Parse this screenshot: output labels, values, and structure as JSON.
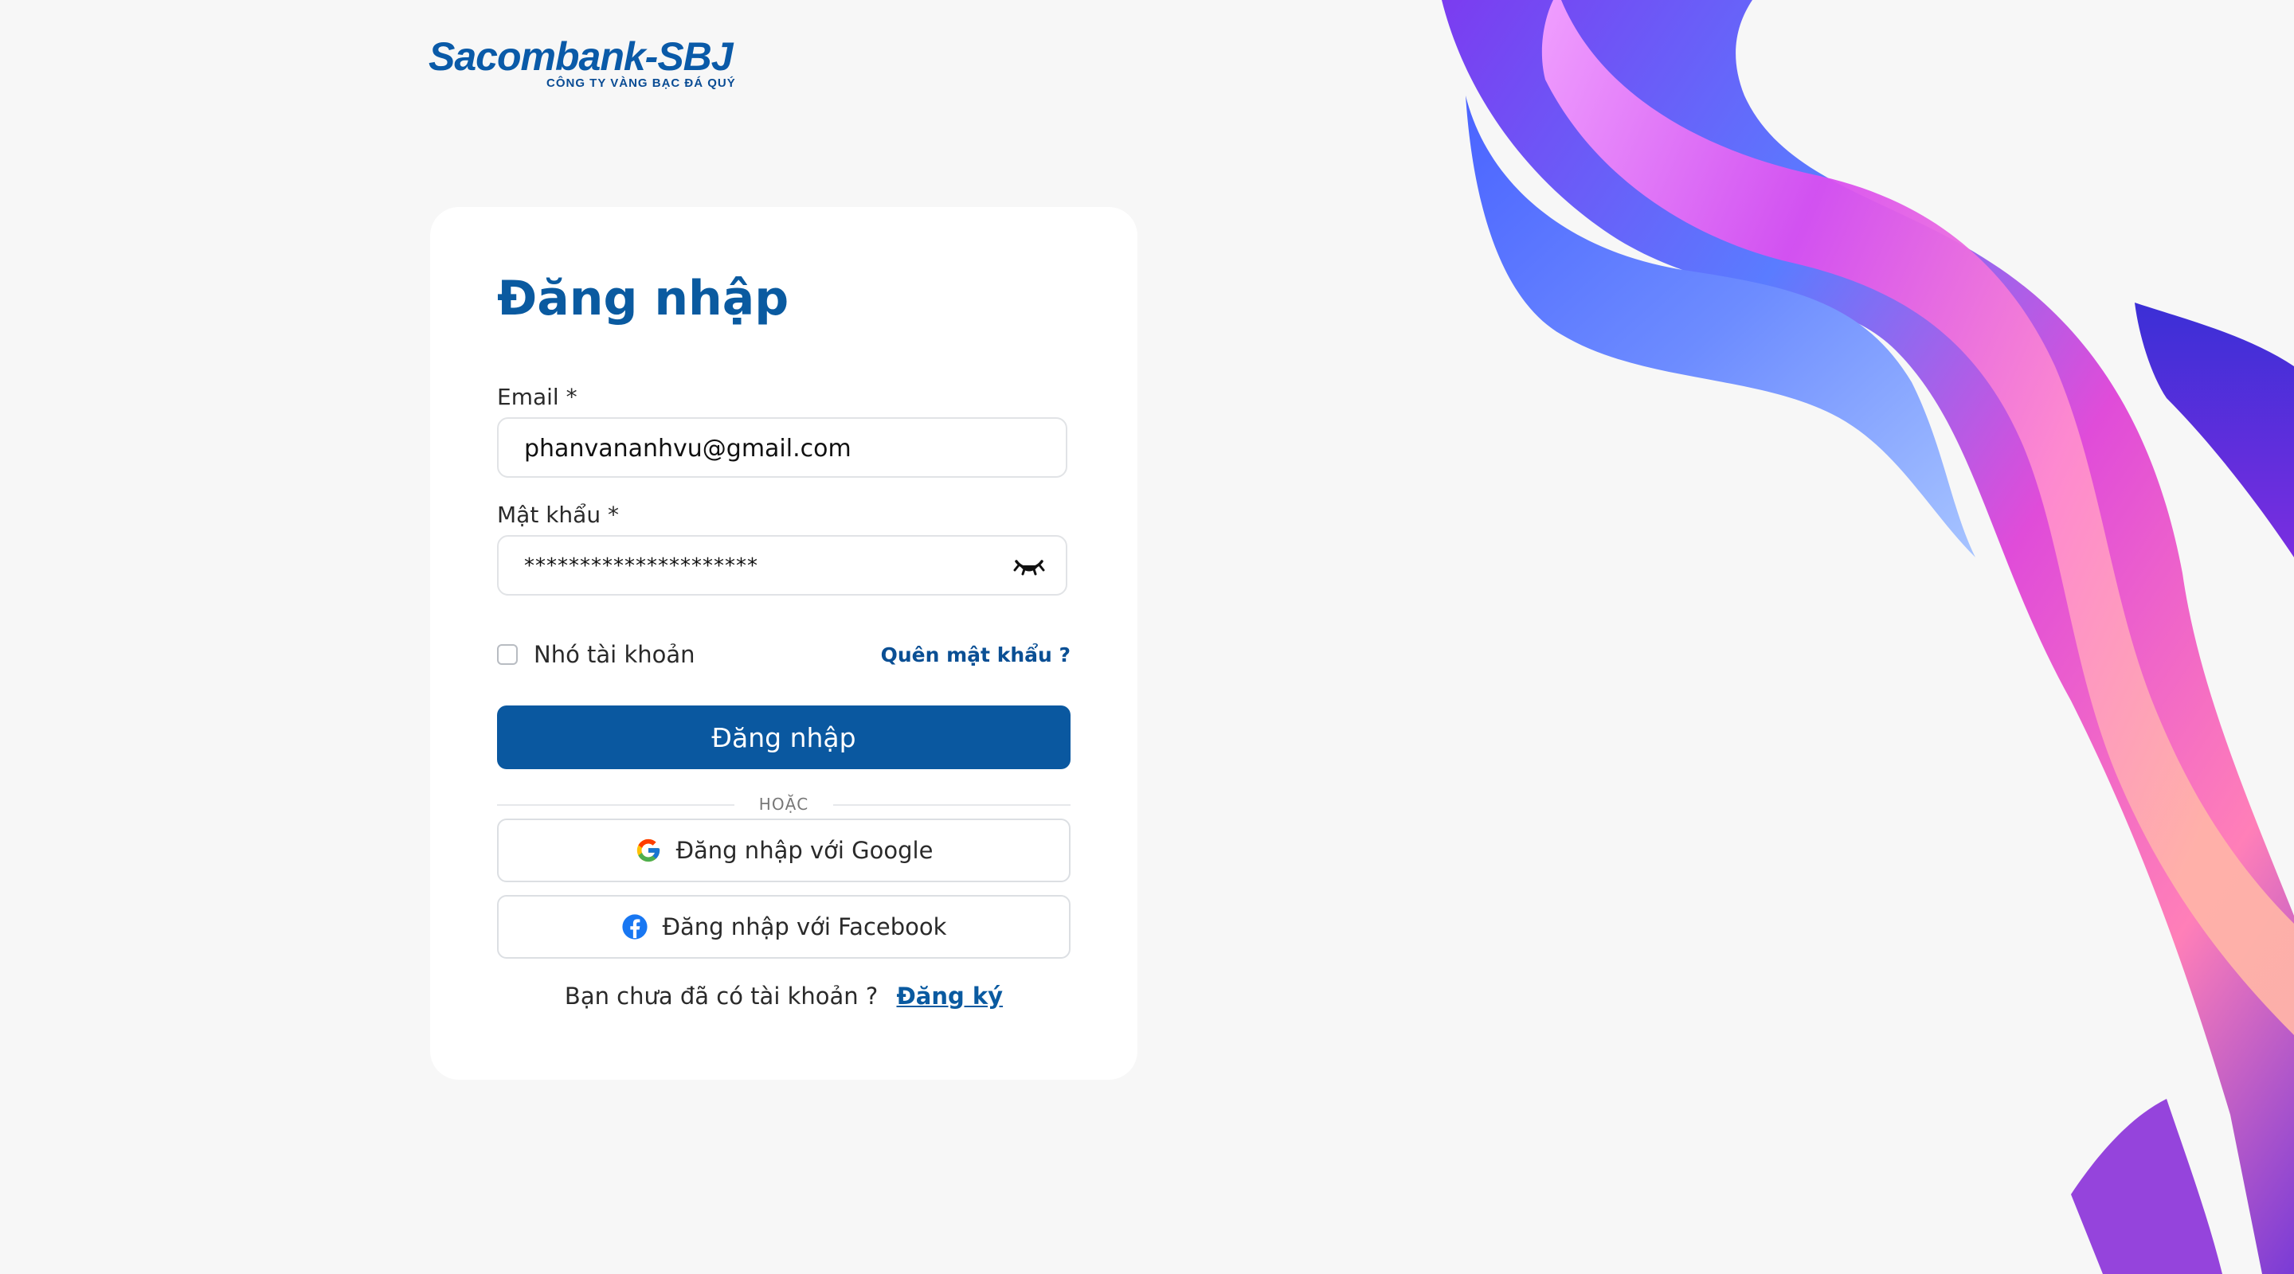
{
  "brand": {
    "name": "Sacombank-SBJ",
    "tagline": "CÔNG TY VÀNG BẠC ĐÁ QUÝ",
    "color": "#0a5aa8"
  },
  "login": {
    "title": "Đăng nhập",
    "email_label": "Email *",
    "email_value": "phanvananhvu@gmail.com",
    "password_label": "Mật khẩu *",
    "password_value": "*********************",
    "remember_label": "Nhó tài khoản",
    "remember_checked": false,
    "forgot_link": "Quên mật khẩu ?",
    "submit_label": "Đăng nhập",
    "divider_label": "HOẶC",
    "google_label": "Đăng nhập với Google",
    "facebook_label": "Đăng nhập với Facebook",
    "signup_prompt": "Bạn chưa đã có tài khoản ?",
    "signup_link": "Đăng ký"
  },
  "icons": {
    "password_toggle": "eye-closed-icon",
    "google": "google-icon",
    "facebook": "facebook-icon"
  },
  "colors": {
    "primary": "#0a58a0",
    "background": "#f7f7f7",
    "card": "#ffffff"
  }
}
